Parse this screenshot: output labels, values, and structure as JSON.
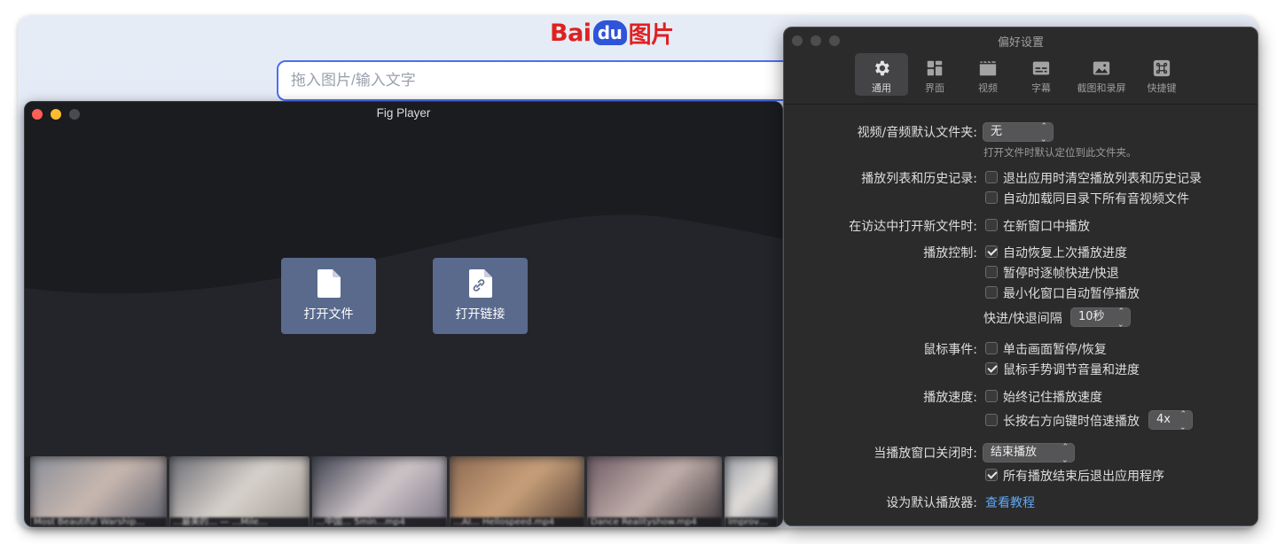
{
  "browser": {
    "logo": {
      "bai": "Bai",
      "du": "du",
      "pic": "图片"
    },
    "search_placeholder": "拖入图片/输入文字"
  },
  "player": {
    "title": "Fig Player",
    "open_file_label": "打开文件",
    "open_link_label": "打开链接",
    "thumbnails": [
      {
        "caption": "Most Beautiful Warship…",
        "colors": [
          "#8a8f98",
          "#c9b8b0",
          "#5a5e6a"
        ]
      },
      {
        "caption": "…最美的… — …Mile…",
        "colors": [
          "#6d6e75",
          "#d8d2cc",
          "#9d9790"
        ]
      },
      {
        "caption": "…中国… 5min…mp4",
        "colors": [
          "#3e4150",
          "#cfc6c8",
          "#7a7585"
        ]
      },
      {
        "caption": "…AI… Hellospeed.mp4",
        "colors": [
          "#8e6a52",
          "#c8a07a",
          "#4d3a30"
        ]
      },
      {
        "caption": "Dance Realityshow.mp4",
        "colors": [
          "#6f5b66",
          "#c2b0ab",
          "#3b3438"
        ]
      },
      {
        "caption": "Improv…",
        "colors": [
          "#9aa0a8",
          "#e4e0dc",
          "#707680"
        ]
      }
    ]
  },
  "prefs": {
    "title": "偏好设置",
    "tabs": [
      {
        "label": "通用",
        "icon": "gear-icon",
        "active": true
      },
      {
        "label": "界面",
        "icon": "layout-icon",
        "active": false
      },
      {
        "label": "视频",
        "icon": "film-icon",
        "active": false
      },
      {
        "label": "字幕",
        "icon": "subtitle-icon",
        "active": false
      },
      {
        "label": "截图和录屏",
        "icon": "photo-icon",
        "active": false
      },
      {
        "label": "快捷键",
        "icon": "command-key-icon",
        "active": false
      }
    ],
    "default_folder_label": "视频/音频默认文件夹:",
    "default_folder_value": "无",
    "default_folder_hint": "打开文件时默认定位到此文件夹。",
    "playlist_label": "播放列表和历史记录:",
    "playlist_opt1": "退出应用时清空播放列表和历史记录",
    "playlist_opt2": "自动加载同目录下所有音视频文件",
    "finder_label": "在访达中打开新文件时:",
    "finder_opt1": "在新窗口中播放",
    "control_label": "播放控制:",
    "control_opt1": "自动恢复上次播放进度",
    "control_opt2": "暂停时逐帧快进/快退",
    "control_opt3": "最小化窗口自动暂停播放",
    "seek_interval_label": "快进/快退间隔",
    "seek_interval_value": "10秒",
    "mouse_label": "鼠标事件:",
    "mouse_opt1": "单击画面暂停/恢复",
    "mouse_opt2": "鼠标手势调节音量和进度",
    "speed_label": "播放速度:",
    "speed_opt1": "始终记住播放速度",
    "speed_opt2": "长按右方向键时倍速播放",
    "speed_value": "4x",
    "close_label": "当播放窗口关闭时:",
    "close_value": "结束播放",
    "close_opt1": "所有播放结束后退出应用程序",
    "default_player_label": "设为默认播放器:",
    "default_player_link": "查看教程",
    "checks": {
      "playlist_opt1": false,
      "playlist_opt2": false,
      "finder_opt1": false,
      "control_opt1": true,
      "control_opt2": false,
      "control_opt3": false,
      "mouse_opt1": false,
      "mouse_opt2": true,
      "speed_opt1": false,
      "speed_opt2": false,
      "close_opt1": true
    }
  }
}
